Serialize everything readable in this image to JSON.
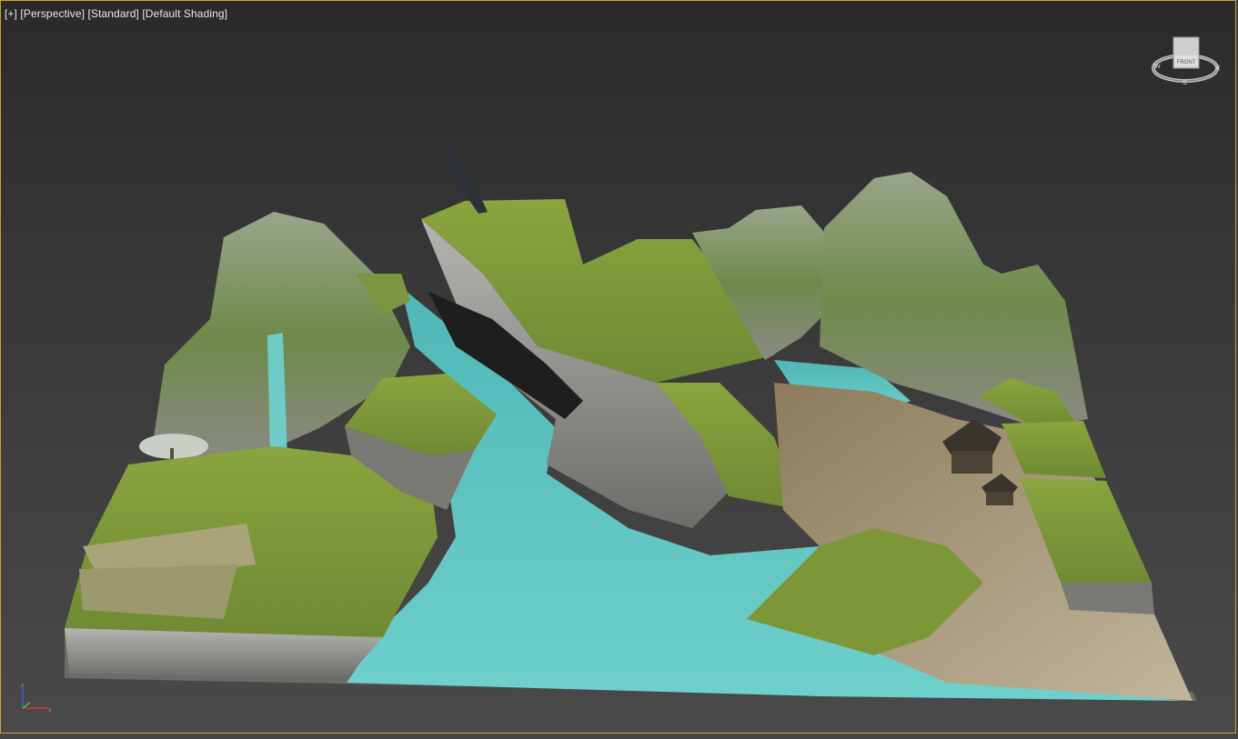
{
  "viewport": {
    "label_plus": "[+]",
    "label_view": "[Perspective]",
    "label_mode": "[Standard]",
    "label_shading": "[Default Shading]"
  },
  "viewcube": {
    "face_label": "FRONT",
    "compass_w": "W",
    "compass_e": "E",
    "compass_s": "S"
  },
  "axis": {
    "z_label": "z",
    "x_label": "x"
  },
  "colors": {
    "viewport_border": "#c8a43a",
    "water": "#5fc6c4",
    "grass": "#7f9a3a",
    "rock": "#8a8a8a",
    "dirt": "#a89574"
  }
}
